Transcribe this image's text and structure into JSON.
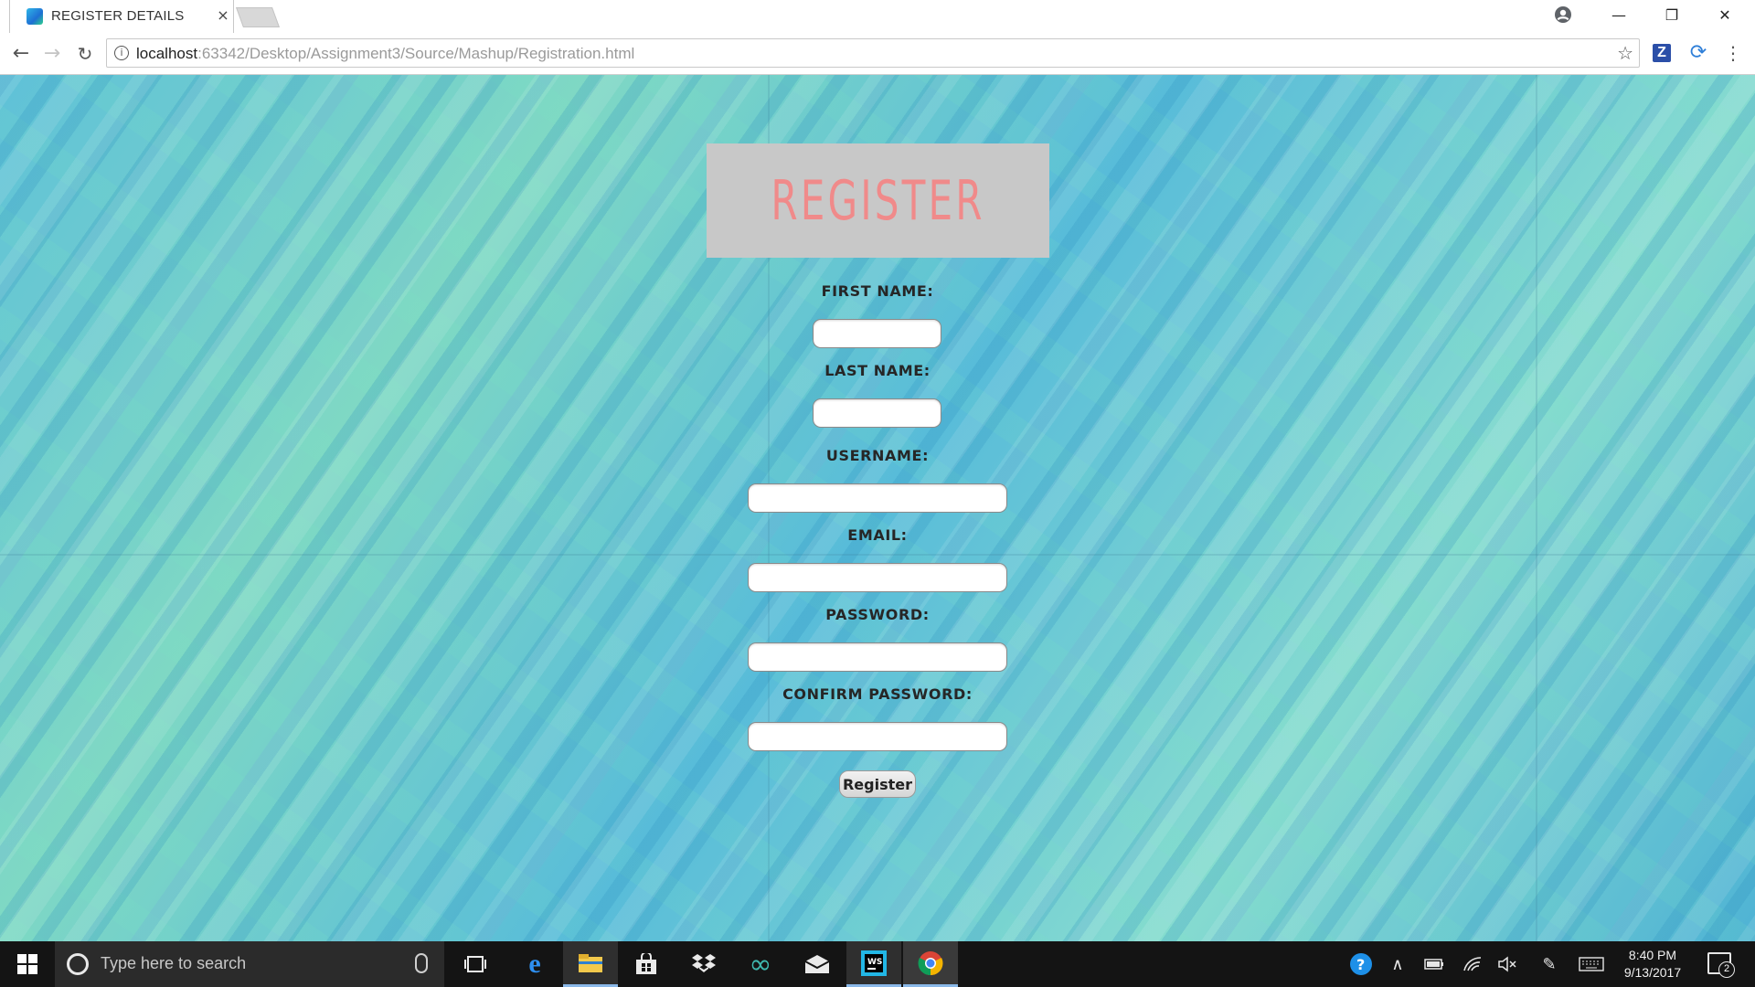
{
  "browser": {
    "tab_title": "REGISTER DETAILS",
    "tab_close": "×",
    "url_host": "localhost",
    "url_rest": ":63342/Desktop/Assignment3/Source/Mashup/Registration.html",
    "window_controls": {
      "minimize": "—",
      "restore": "❐",
      "close": "✕"
    }
  },
  "page": {
    "banner_title": "REGISTER",
    "fields": [
      {
        "label": "FIRST NAME:",
        "value": ""
      },
      {
        "label": "LAST NAME:",
        "value": ""
      },
      {
        "label": "USERNAME:",
        "value": ""
      },
      {
        "label": "EMAIL:",
        "value": ""
      },
      {
        "label": "PASSWORD:",
        "value": ""
      },
      {
        "label": "CONFIRM PASSWORD:",
        "value": ""
      }
    ],
    "submit_label": "Register"
  },
  "taskbar": {
    "search_placeholder": "Type here to search",
    "clock_time": "8:40 PM",
    "clock_date": "9/13/2017",
    "notification_count": "2"
  },
  "colors": {
    "banner_bg": "#c8c8c8",
    "banner_text": "#f08a8a",
    "label_text": "#262626"
  }
}
